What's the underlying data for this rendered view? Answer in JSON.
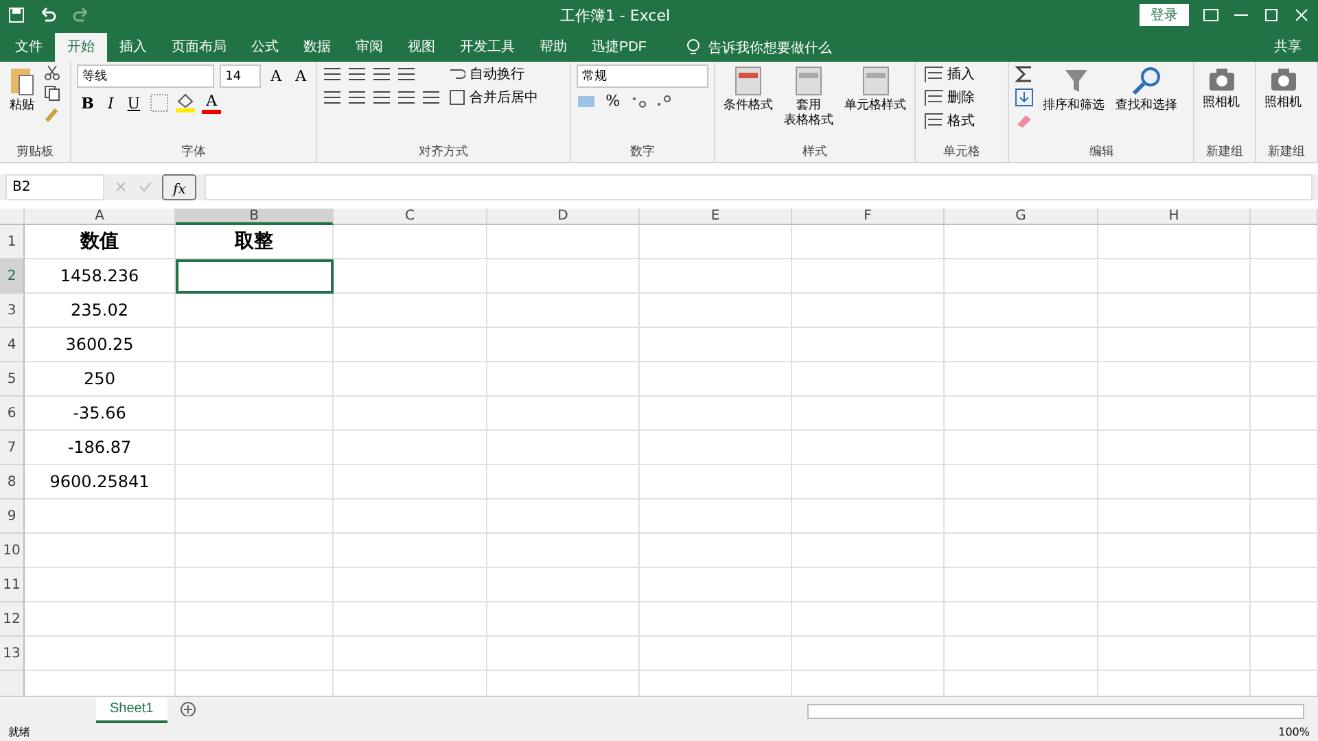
{
  "title_bar": {
    "title": "工作簿1 - Excel",
    "login": "登录"
  },
  "tabs": [
    {
      "label": "文件",
      "selected": false
    },
    {
      "label": "开始",
      "selected": true
    },
    {
      "label": "插入",
      "selected": false
    },
    {
      "label": "页面布局",
      "selected": false
    },
    {
      "label": "公式",
      "selected": false
    },
    {
      "label": "数据",
      "selected": false
    },
    {
      "label": "审阅",
      "selected": false
    },
    {
      "label": "视图",
      "selected": false
    },
    {
      "label": "开发工具",
      "selected": false
    },
    {
      "label": "帮助",
      "selected": false
    },
    {
      "label": "迅捷PDF",
      "selected": false
    }
  ],
  "tell_me": "告诉我你想要做什么",
  "share": "共享",
  "ribbon": {
    "clipboard": {
      "label": "剪贴板",
      "paste": "粘贴"
    },
    "font": {
      "label": "字体",
      "font_name": "等线",
      "font_size": "14",
      "size_buttons": [
        "A",
        "A"
      ],
      "style_buttons": [
        "B",
        "I",
        "U"
      ],
      "font_color": "A"
    },
    "alignment": {
      "label": "对齐方式",
      "wrap": "自动换行",
      "merge": "合并后居中"
    },
    "number": {
      "label": "数字",
      "format": "常规",
      "percent": "%"
    },
    "styles": {
      "label": "样式",
      "buttons": [
        {
          "lines": [
            "条件格式"
          ]
        },
        {
          "lines": [
            "套用",
            "表格格式"
          ]
        },
        {
          "lines": [
            "单元格样式"
          ]
        }
      ]
    },
    "cells": {
      "label": "单元格",
      "items": [
        "插入",
        "删除",
        "格式"
      ]
    },
    "editing": {
      "label": "编辑",
      "buttons": [
        "排序和筛选",
        "查找和选择"
      ]
    },
    "custom_groups": [
      {
        "button": "照相机",
        "label": "新建组"
      },
      {
        "button": "照相机",
        "label": "新建组"
      }
    ]
  },
  "formula_bar": {
    "name_box": "B2",
    "fx": "fx"
  },
  "sheet": {
    "columns": [
      {
        "label": "A",
        "selected": false
      },
      {
        "label": "B",
        "selected": true
      },
      {
        "label": "C",
        "selected": false
      },
      {
        "label": "D",
        "selected": false
      },
      {
        "label": "E",
        "selected": false
      },
      {
        "label": "F",
        "selected": false
      },
      {
        "label": "G",
        "selected": false
      },
      {
        "label": "H",
        "selected": false
      }
    ],
    "rows": [
      {
        "number": "1",
        "selected": false,
        "cells": [
          "数值",
          "取整"
        ]
      },
      {
        "number": "2",
        "selected": true,
        "cells": [
          "1458.236"
        ]
      },
      {
        "number": "3",
        "selected": false,
        "cells": [
          "235.02"
        ]
      },
      {
        "number": "4",
        "selected": false,
        "cells": [
          "3600.25"
        ]
      },
      {
        "number": "5",
        "selected": false,
        "cells": [
          "250"
        ]
      },
      {
        "number": "6",
        "selected": false,
        "cells": [
          "-35.66"
        ]
      },
      {
        "number": "7",
        "selected": false,
        "cells": [
          "-186.87"
        ]
      },
      {
        "number": "8",
        "selected": false,
        "cells": [
          "9600.25841"
        ]
      },
      {
        "number": "9",
        "selected": false,
        "cells": []
      },
      {
        "number": "10",
        "selected": false,
        "cells": []
      },
      {
        "number": "11",
        "selected": false,
        "cells": []
      },
      {
        "number": "12",
        "selected": false,
        "cells": []
      },
      {
        "number": "13",
        "selected": false,
        "cells": []
      }
    ]
  },
  "sheet_tabs": [
    {
      "label": "Sheet1",
      "selected": true
    }
  ],
  "status_bar": {
    "status": "就绪",
    "zoom": "100%"
  }
}
